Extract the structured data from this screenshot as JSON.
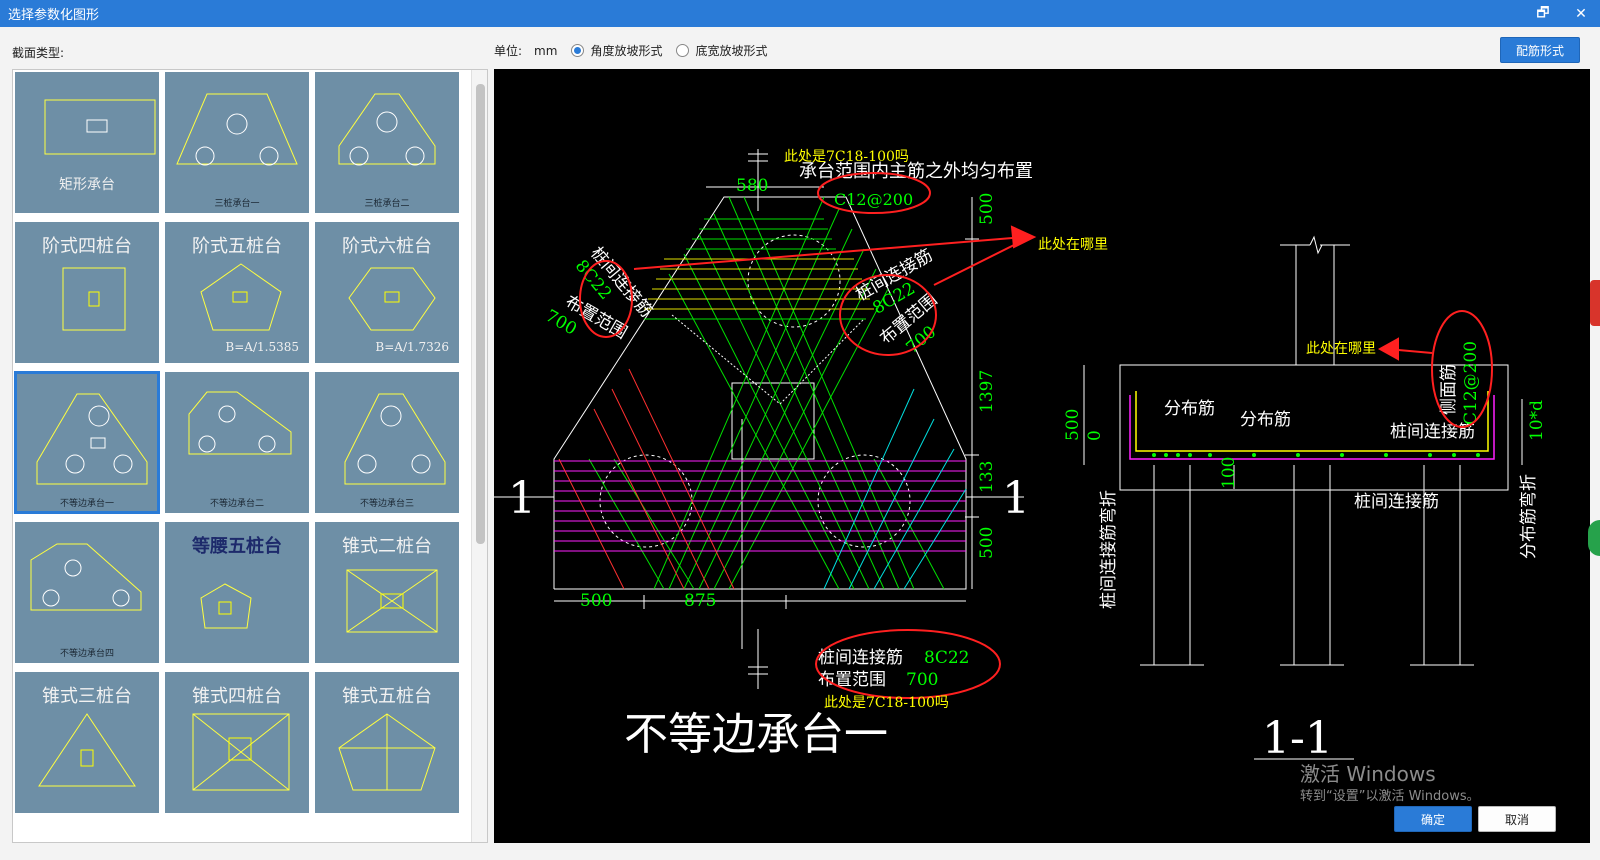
{
  "window": {
    "title": "选择参数化图形",
    "restore_glyph": "🗗",
    "close_glyph": "✕"
  },
  "labels": {
    "section_type": "截面类型:",
    "unit_label": "单位:",
    "unit_value": "mm",
    "radio_angle": "角度放坡形式",
    "radio_width": "底宽放坡形式",
    "rebar_form_button": "配筋形式",
    "ok_button": "确定",
    "cancel_button": "取消"
  },
  "radios": {
    "selected": "radio_angle"
  },
  "tiles": [
    {
      "caption": "矩形承台",
      "style": "bottom"
    },
    {
      "caption": "三桩承台一",
      "style": "small"
    },
    {
      "caption": "三桩承台二",
      "style": "small"
    },
    {
      "caption": "阶式四桩台",
      "style": "top"
    },
    {
      "caption": "阶式五桩台",
      "style": "top",
      "sub": "B=A/1.5385"
    },
    {
      "caption": "阶式六桩台",
      "style": "top",
      "sub": "B=A/1.7326"
    },
    {
      "caption": "不等边承台一",
      "style": "small",
      "selected": true
    },
    {
      "caption": "不等边承台二",
      "style": "small"
    },
    {
      "caption": "不等边承台三",
      "style": "small"
    },
    {
      "caption": "不等边承台四",
      "style": "small"
    },
    {
      "caption": "等腰五桩台",
      "style": "top-dark"
    },
    {
      "caption": "锥式二桩台",
      "style": "top"
    },
    {
      "caption": "锥式三桩台",
      "style": "top"
    },
    {
      "caption": "锥式四桩台",
      "style": "top"
    },
    {
      "caption": "锥式五桩台",
      "style": "top"
    }
  ],
  "drawing": {
    "main_title": "不等边承台一",
    "section_title": "1-1",
    "section_mark_left": "1",
    "section_mark_right": "1",
    "dims": {
      "top_width": "580",
      "bottom_left": "500",
      "bottom_mid": "875",
      "right_1": "500",
      "right_2": "1397",
      "right_3": "133",
      "right_4": "500",
      "sec_left_1": "500",
      "sec_left_2": "0",
      "sec_100": "100",
      "sec_10d": "10*d"
    },
    "rebar": {
      "top_note": "承台范围内主筋之外均匀布置",
      "top_spec": "C12@200",
      "left_name": "桩间连接筋",
      "left_spec": "8C22",
      "left_range": "布置范围",
      "left_range_val": "700",
      "right_name": "桩间连接筋",
      "right_spec": "8C22",
      "right_range": "布置范围",
      "right_range_val": "700",
      "bottom_name": "桩间连接筋",
      "bottom_spec": "8C22",
      "bottom_range": "布置范围",
      "bottom_range_val": "700",
      "sec_dist1": "分布筋",
      "sec_dist2": "分布筋",
      "sec_link": "桩间连接筋",
      "sec_link2": "桩间连接筋",
      "sec_side": "侧面筋",
      "sec_side_spec": "C12@200",
      "sec_left_vert": "桩间连接筋弯折",
      "sec_right_vert": "分布筋弯折"
    },
    "annotations": {
      "a1": "此处是7C18-100吗",
      "a2": "此处在哪里",
      "a3": "此处在哪里",
      "a4": "此处是7C18-100吗"
    }
  },
  "watermark": {
    "line1": "激活 Windows",
    "line2": "转到“设置”以激活 Windows。"
  },
  "colors": {
    "title_bar": "#2a7bd7",
    "tile_bg": "#6e8fa6",
    "cad_bg": "#000000",
    "green": "#00ff00",
    "yellow": "#ffff00",
    "magenta": "#ff00ff",
    "cyan": "#00ffff",
    "red": "#ff2020",
    "white": "#ffffff"
  }
}
